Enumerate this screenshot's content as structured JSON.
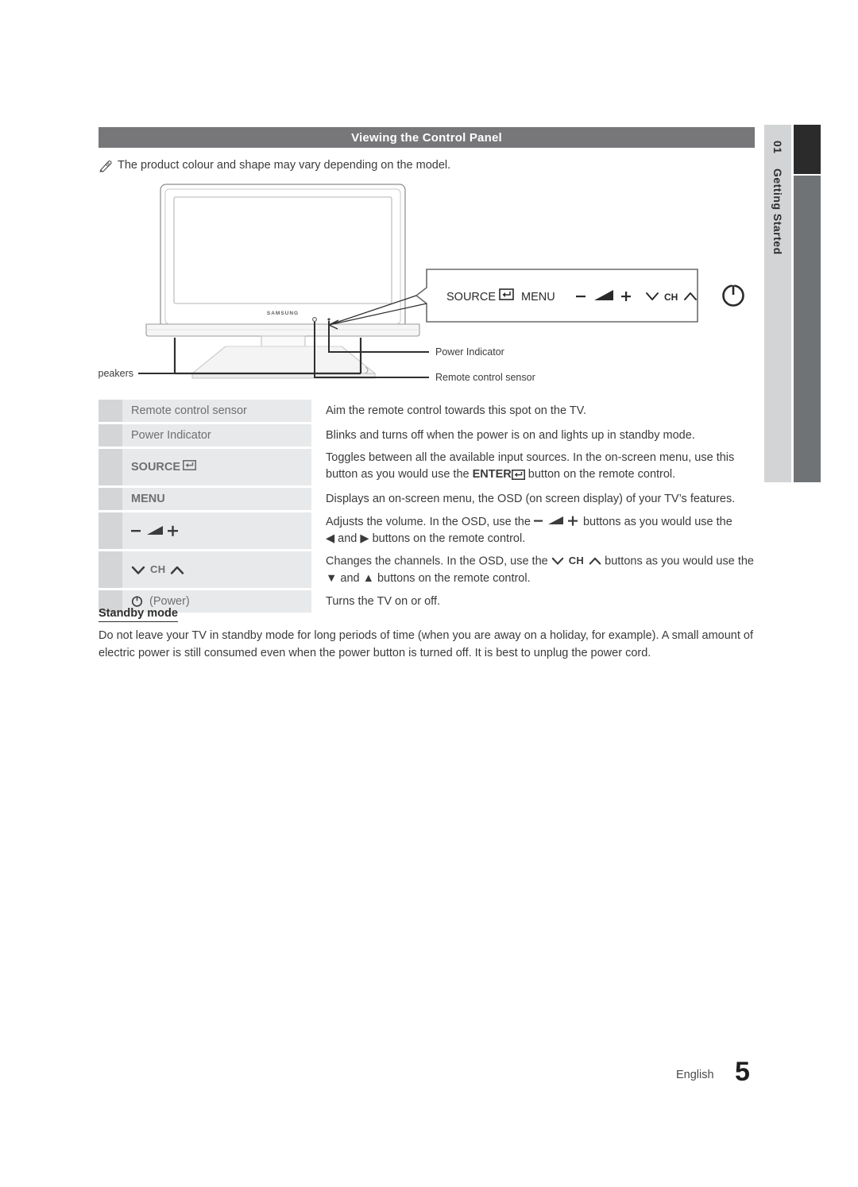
{
  "header": {
    "title": "Viewing the Control Panel"
  },
  "note": {
    "icon": "pencil-note-icon",
    "text": "The product colour and shape may vary depending on the model."
  },
  "illustration": {
    "brand": "SAMSUNG",
    "panel_buttons": [
      "SOURCE",
      "MENU",
      "−",
      "+",
      "CH",
      "power"
    ],
    "panel_labels": {
      "source": "SOURCE",
      "menu": "MENU",
      "minus": "−",
      "plus": "+",
      "ch": "CH"
    },
    "callouts": [
      {
        "name": "speakers",
        "label": "Speakers"
      },
      {
        "name": "power-indicator",
        "label": "Power Indicator"
      },
      {
        "name": "remote-control-sensor",
        "label": "Remote control sensor"
      }
    ]
  },
  "table": {
    "rows": [
      {
        "key": "Remote control sensor",
        "key_type": "text",
        "lines": [
          "Aim the remote control towards this spot on the TV."
        ]
      },
      {
        "key": "Power Indicator",
        "key_type": "text",
        "lines": [
          "Blinks and turns off when the power is on and lights up in standby mode."
        ]
      },
      {
        "key": "SOURCE",
        "key_type": "source",
        "lines": [
          "Toggles between all the available input sources. In the on-screen menu, use this",
          "button as you would use the ENTER",
          " button on the remote control."
        ]
      },
      {
        "key": "MENU",
        "key_type": "menu",
        "lines": [
          "Displays an on-screen menu, the OSD (on screen display) of your TV’s features."
        ]
      },
      {
        "key": "−  ◢  +",
        "key_type": "volume",
        "lines": [
          "Adjusts the volume. In the OSD, use the − ◢ + buttons as you would use the",
          "◀ and ▶ buttons on the remote control."
        ]
      },
      {
        "key": "∨ CH ∧",
        "key_type": "channel",
        "lines": [
          "Changes the channels. In the OSD, use the ∨ CH ∧ buttons as you would use the",
          "▼ and ▲ buttons on the remote control."
        ]
      },
      {
        "key": "(Power)",
        "key_type": "power",
        "lines": [
          "Turns the TV on or off."
        ]
      }
    ],
    "inline": {
      "volume_prefix": "Adjusts the volume. In the OSD, use the ",
      "volume_suffix": " buttons as you would use the",
      "volume_line2": "◀ and ▶ buttons on the remote control.",
      "channel_prefix": "Changes the channels. In the OSD, use the ",
      "channel_word": "CH",
      "channel_suffix": " buttons as you would use the",
      "channel_line2": "▼ and ▲ buttons on the remote control.",
      "source_line1": "Toggles between all the available input sources. In the on-screen menu, use this",
      "source_line2_pre": "button as you would use the ",
      "source_enter": "ENTER",
      "source_line2_post": " button on the remote control."
    }
  },
  "standby": {
    "title": "Standby mode",
    "line1": "Do not leave your TV in standby mode for long periods of time (when you are away on a holiday, for example). A small amount",
    "line2": "of electric power is still consumed even when the power button is turned off. It is best to unplug the power cord."
  },
  "sidebar": {
    "chapter_number": "01",
    "chapter_title": "Getting Started"
  },
  "footer": {
    "language": "English",
    "page_number": "5"
  },
  "colors": {
    "header_bar": "#77777a",
    "key_cell": "#e8e9ea",
    "key_swatch": "#d3d5d7",
    "sidebar_light": "#d2d4d6",
    "sidebar_dark": "#2b2b2b",
    "sidebar_gray": "#6f7376",
    "text": "#3b3b3b"
  }
}
